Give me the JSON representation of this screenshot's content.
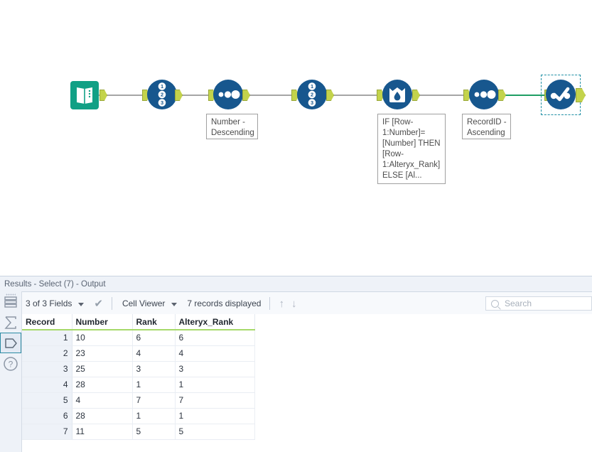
{
  "canvas": {
    "nodes": [
      {
        "id": "input-data",
        "icon": "book-icon",
        "label": ""
      },
      {
        "id": "record-id-1",
        "icon": "record-id-123-icon",
        "label": ""
      },
      {
        "id": "sort-1",
        "icon": "sort-dots-icon",
        "label": "Number -\nDescending"
      },
      {
        "id": "record-id-2",
        "icon": "record-id-123-icon",
        "label": ""
      },
      {
        "id": "multi-row-formula",
        "icon": "multi-row-formula-icon",
        "label": "IF [Row-\n1:Number]=\n[Number] THEN\n[Row-\n1:Alteryx_Rank]\nELSE [Al..."
      },
      {
        "id": "sort-2",
        "icon": "sort-dots-icon",
        "label": "RecordID -\nAscending"
      },
      {
        "id": "select",
        "icon": "select-check-icon",
        "label": ""
      }
    ],
    "colors": {
      "tool_blue": "#17578e",
      "input_teal": "#11a085",
      "connector_green": "#c3d34b",
      "wire_gray": "#a6a6a6",
      "wire_active_green": "#1f9e63",
      "selection_dash": "#1f8fa4"
    }
  },
  "results": {
    "title": "Results - Select (7) - Output",
    "toolbar": {
      "fields_label": "3 of 3 Fields",
      "viewer_label": "Cell Viewer",
      "records_label": "7 records displayed",
      "up_arrow": "↑",
      "down_arrow": "↓",
      "check": "✔"
    },
    "search": {
      "value": "",
      "placeholder": "Search"
    },
    "rail": [
      {
        "id": "data-rows",
        "icon": "rows-stack-icon",
        "selected": false
      },
      {
        "id": "profile",
        "icon": "sigma-icon",
        "selected": false
      },
      {
        "id": "metadata",
        "icon": "tag-icon",
        "selected": true
      },
      {
        "id": "help",
        "icon": "question-mark-icon",
        "selected": false
      }
    ],
    "table": {
      "columns": [
        "Record",
        "Number",
        "Rank",
        "Alteryx_Rank"
      ],
      "rows": [
        [
          "1",
          "10",
          "6",
          "6"
        ],
        [
          "2",
          "23",
          "4",
          "4"
        ],
        [
          "3",
          "25",
          "3",
          "3"
        ],
        [
          "4",
          "28",
          "1",
          "1"
        ],
        [
          "5",
          "4",
          "7",
          "7"
        ],
        [
          "6",
          "28",
          "1",
          "1"
        ],
        [
          "7",
          "11",
          "5",
          "5"
        ]
      ]
    }
  }
}
